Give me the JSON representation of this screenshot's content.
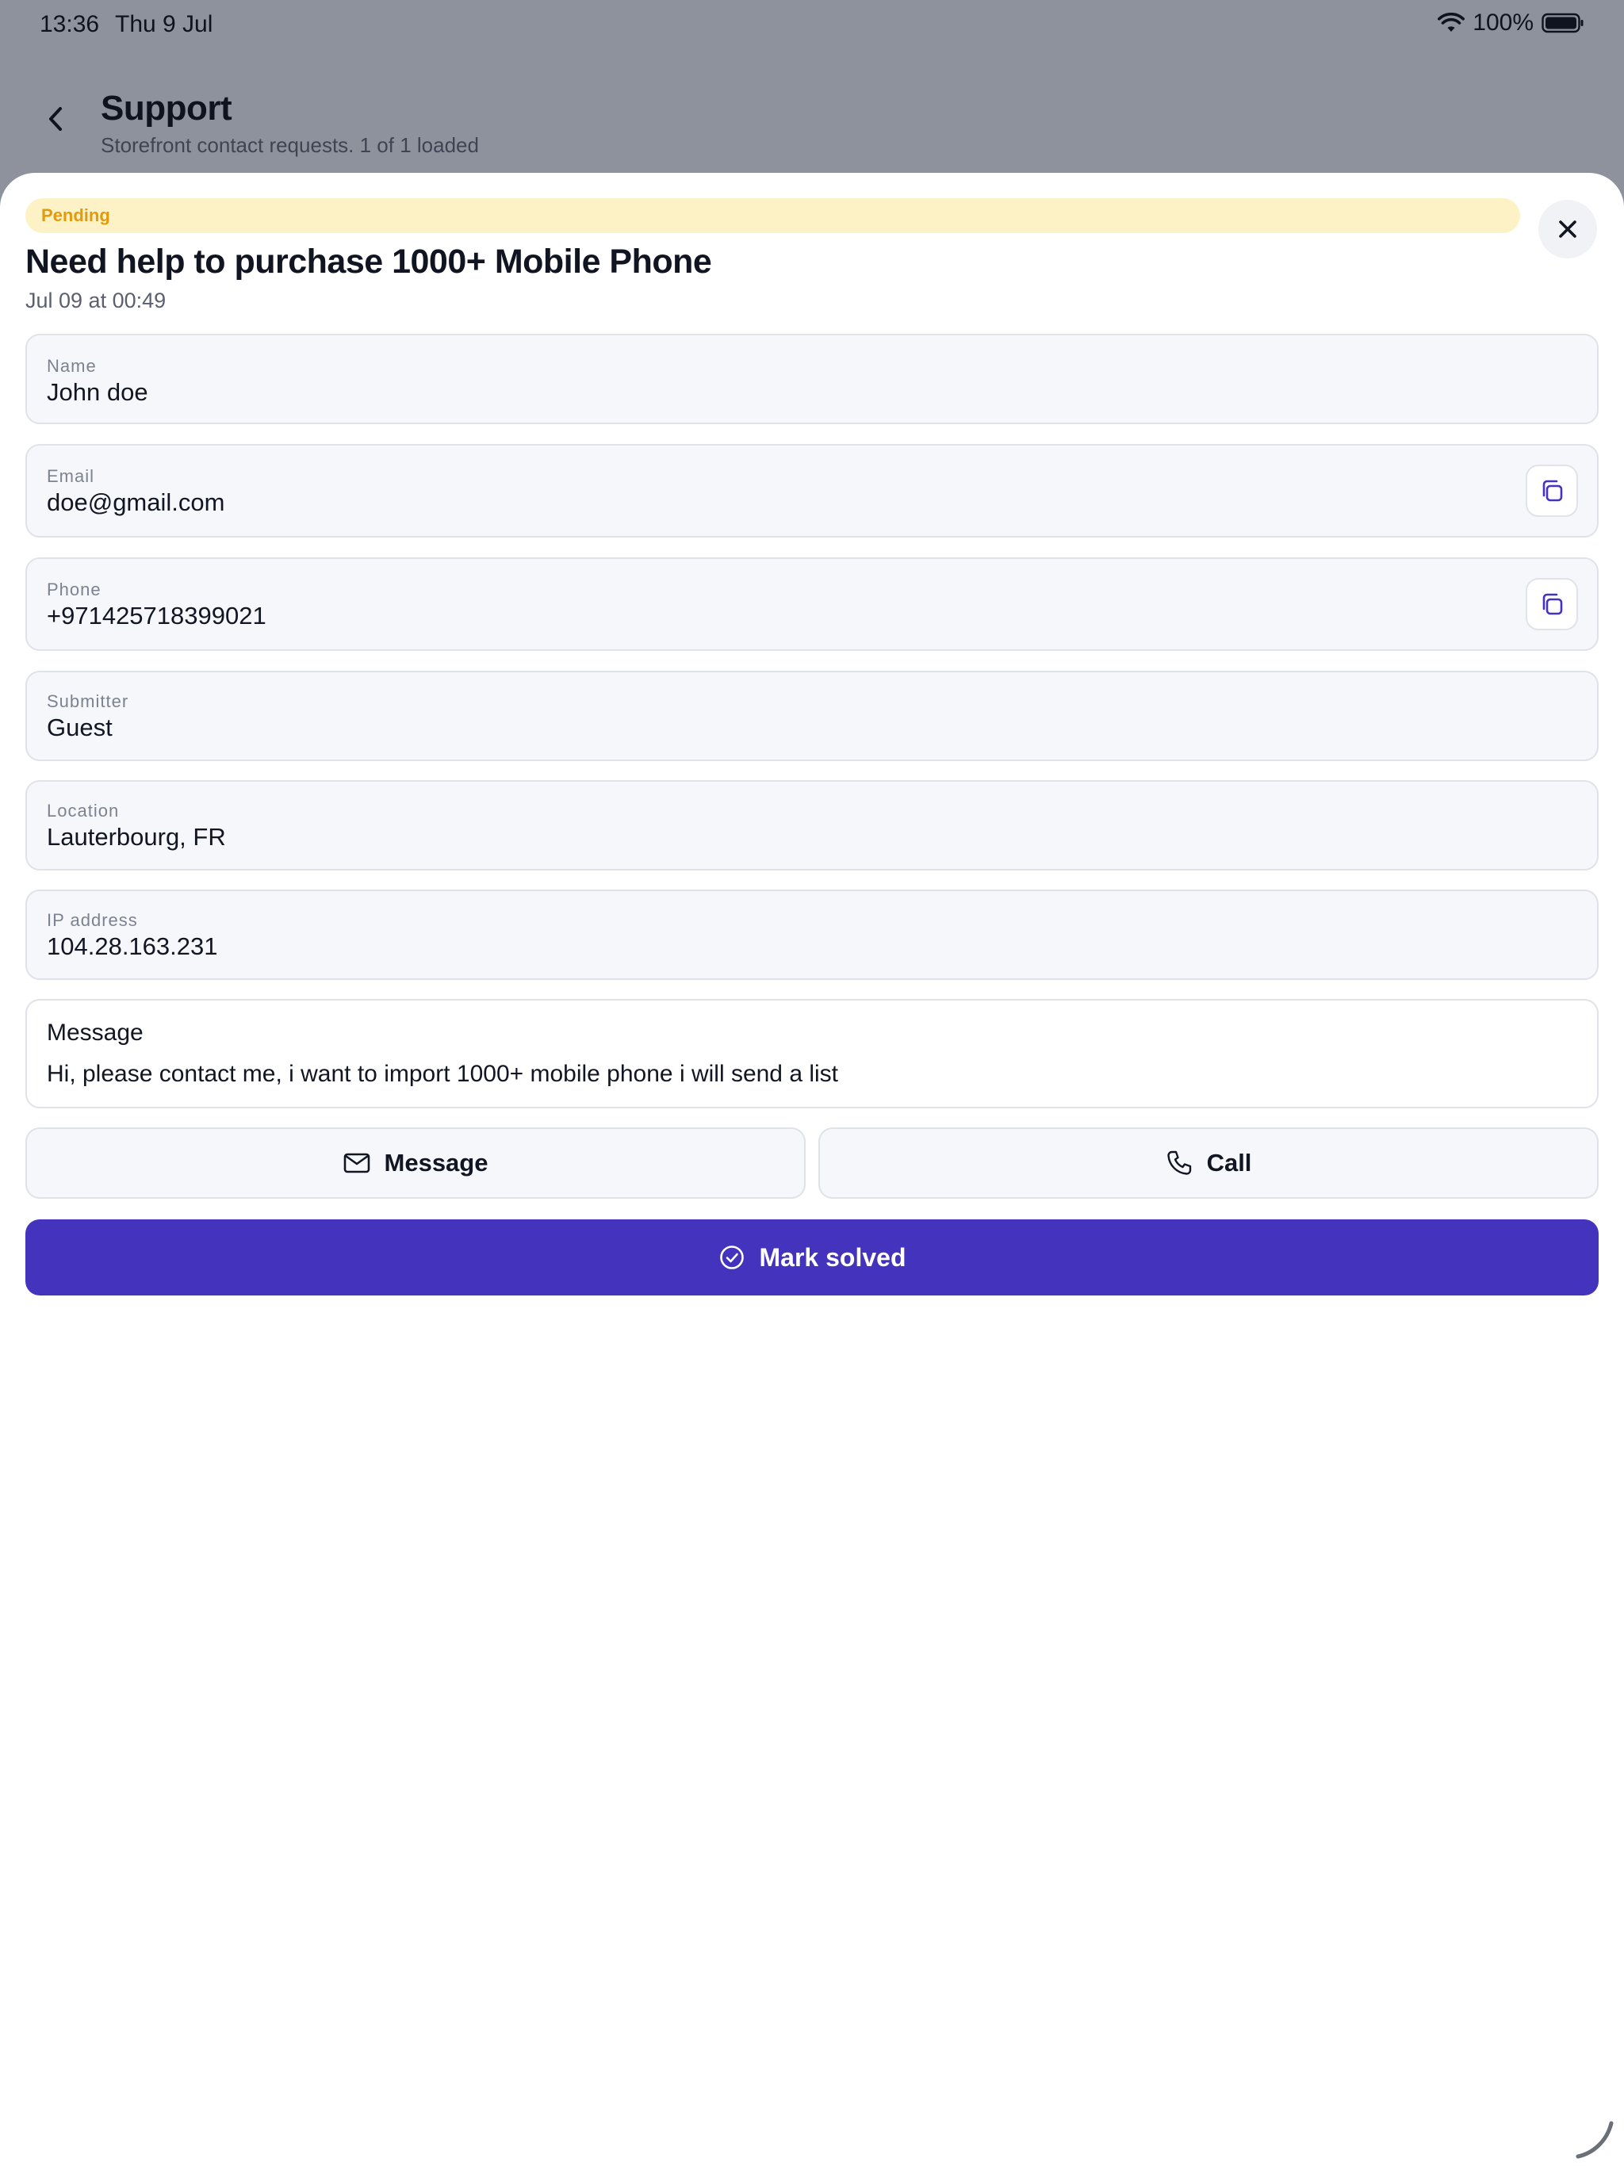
{
  "status_bar": {
    "time": "13:36",
    "date": "Thu 9 Jul",
    "battery_percent": "100%"
  },
  "background_header": {
    "title": "Support",
    "subtitle": "Storefront contact requests. 1 of 1 loaded"
  },
  "sheet": {
    "status_badge": "Pending",
    "title": "Need help to purchase 1000+ Mobile Phone",
    "date": "Jul 09 at 00:49",
    "fields": {
      "name": {
        "label": "Name",
        "value": "John doe"
      },
      "email": {
        "label": "Email",
        "value": "doe@gmail.com"
      },
      "phone": {
        "label": "Phone",
        "value": "+971425718399021"
      },
      "submitter": {
        "label": "Submitter",
        "value": "Guest"
      },
      "location": {
        "label": "Location",
        "value": "Lauterbourg, FR"
      },
      "ip": {
        "label": "IP address",
        "value": "104.28.163.231"
      }
    },
    "message": {
      "title": "Message",
      "text": "Hi, please contact me, i want to import 1000+ mobile phone i will send a list"
    },
    "actions": {
      "message_label": "Message",
      "call_label": "Call",
      "mark_solved_label": "Mark solved"
    }
  },
  "colors": {
    "accent": "#4433bd",
    "pending_bg": "#fdf1c6",
    "pending_text": "#e39a0c",
    "overlay": "#8e929c"
  },
  "icons": {
    "back": "chevron-left-icon",
    "close": "close-icon",
    "copy": "copy-icon",
    "message": "envelope-icon",
    "call": "phone-icon",
    "solved": "check-circle-icon"
  }
}
